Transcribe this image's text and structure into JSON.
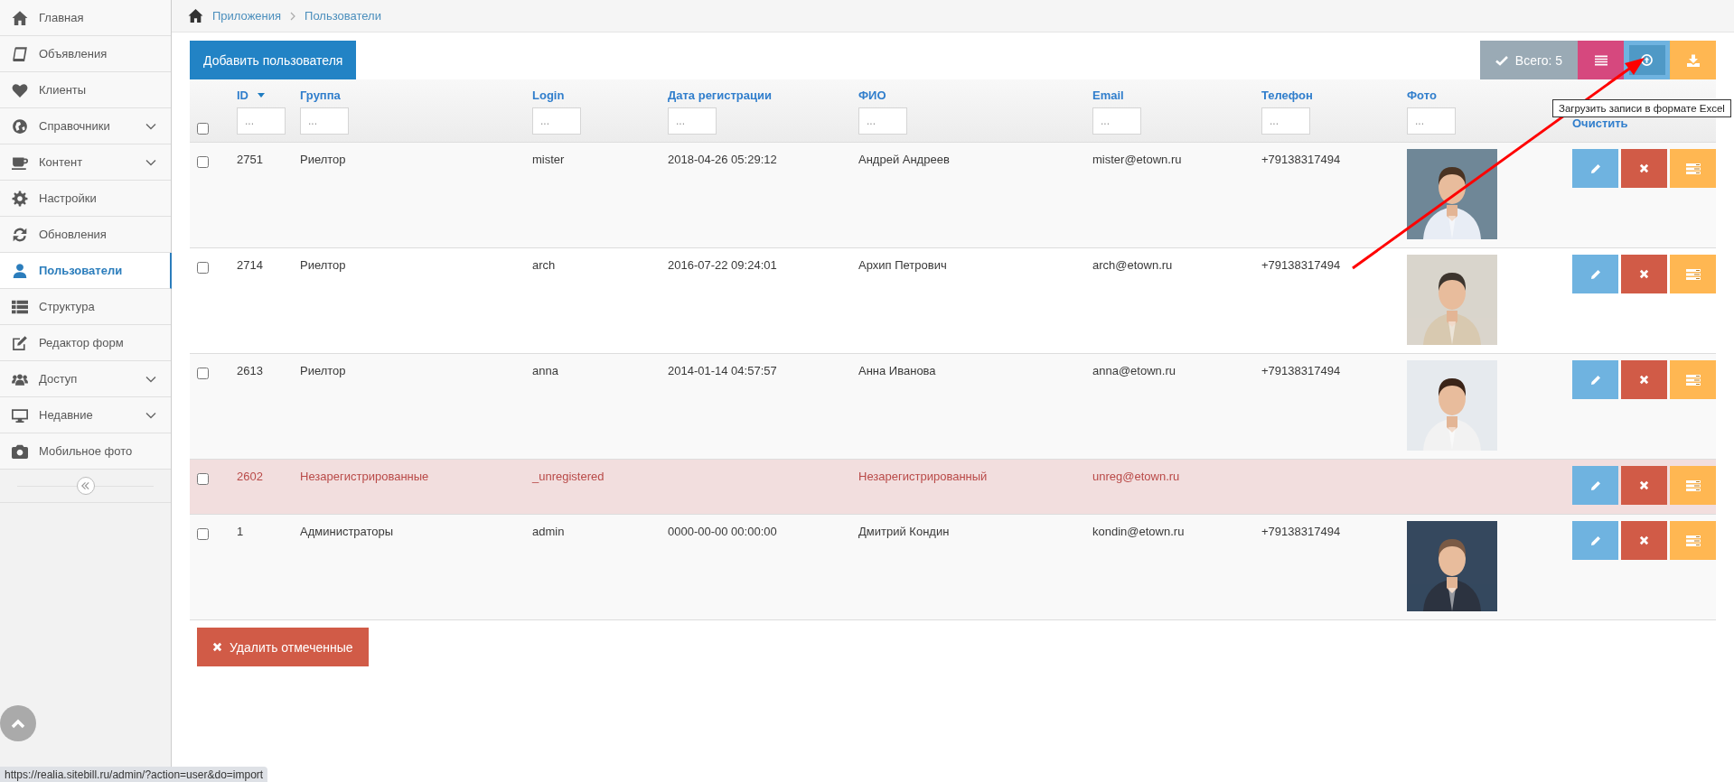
{
  "sidebar": {
    "items": [
      {
        "label": "Главная",
        "selected": false,
        "submenu": false
      },
      {
        "label": "Объявления",
        "selected": false,
        "submenu": false
      },
      {
        "label": "Клиенты",
        "selected": false,
        "submenu": false
      },
      {
        "label": "Справочники",
        "selected": false,
        "submenu": true
      },
      {
        "label": "Контент",
        "selected": false,
        "submenu": true
      },
      {
        "label": "Настройки",
        "selected": false,
        "submenu": false
      },
      {
        "label": "Обновления",
        "selected": false,
        "submenu": false
      },
      {
        "label": "Пользователи",
        "selected": true,
        "submenu": false
      },
      {
        "label": "Структура",
        "selected": false,
        "submenu": false
      },
      {
        "label": "Редактор форм",
        "selected": false,
        "submenu": false
      },
      {
        "label": "Доступ",
        "selected": false,
        "submenu": true
      },
      {
        "label": "Недавние",
        "selected": false,
        "submenu": true
      },
      {
        "label": "Мобильное фото",
        "selected": false,
        "submenu": false
      }
    ]
  },
  "breadcrumb": [
    {
      "label": "Приложения"
    },
    {
      "label": "Пользователи"
    }
  ],
  "toolbar": {
    "add_button": "Добавить пользователя",
    "total": "Всего: 5",
    "total_disabled": true,
    "tooltip": "Загрузить записи в формате Excel"
  },
  "table": {
    "columns": [
      {
        "label": "ID",
        "sorted": true,
        "placeholder": "..."
      },
      {
        "label": "Группа",
        "sorted": false,
        "placeholder": "..."
      },
      {
        "label": "Login",
        "sorted": false,
        "placeholder": "..."
      },
      {
        "label": "Дата регистрации",
        "sorted": false,
        "placeholder": "..."
      },
      {
        "label": "ФИО",
        "sorted": false,
        "placeholder": "..."
      },
      {
        "label": "Email",
        "sorted": false,
        "placeholder": "..."
      },
      {
        "label": "Телефон",
        "sorted": false,
        "placeholder": "..."
      },
      {
        "label": "Фото",
        "sorted": false,
        "placeholder": "..."
      }
    ],
    "clear_link": "Очистить",
    "select_all_checked": false,
    "rows": [
      {
        "id": "2751",
        "group": "Риелтор",
        "login": "mister",
        "registered": "2018-04-26 05:29:12",
        "name": "Андрей Андреев",
        "email": "mister@etown.ru",
        "phone": "+79138317494",
        "photo": true,
        "highlighted": false,
        "checked": false
      },
      {
        "id": "2714",
        "group": "Риелтор",
        "login": "arch",
        "registered": "2016-07-22 09:24:01",
        "name": "Архип Петрович",
        "email": "arch@etown.ru",
        "phone": "+79138317494",
        "photo": true,
        "highlighted": false,
        "checked": false
      },
      {
        "id": "2613",
        "group": "Риелтор",
        "login": "anna",
        "registered": "2014-01-14 04:57:57",
        "name": "Анна Иванова",
        "email": "anna@etown.ru",
        "phone": "+79138317494",
        "photo": true,
        "highlighted": false,
        "checked": false
      },
      {
        "id": "2602",
        "group": "Незарегистрированные",
        "login": "_unregistered",
        "name": "Незарегистрированный",
        "email": "unreg@etown.ru",
        "photo": false,
        "highlighted": true,
        "checked": false
      },
      {
        "id": "1",
        "group": "Администраторы",
        "login": "admin",
        "registered": "0000-00-00 00:00:00",
        "name": "Дмитрий Кондин",
        "email": "kondin@etown.ru",
        "phone": "+79138317494",
        "photo": true,
        "highlighted": false,
        "checked": false
      }
    ]
  },
  "delete_button": "Удалить отмеченные",
  "status_url": "https://realia.sitebill.ru/admin/?action=user&do=import"
}
